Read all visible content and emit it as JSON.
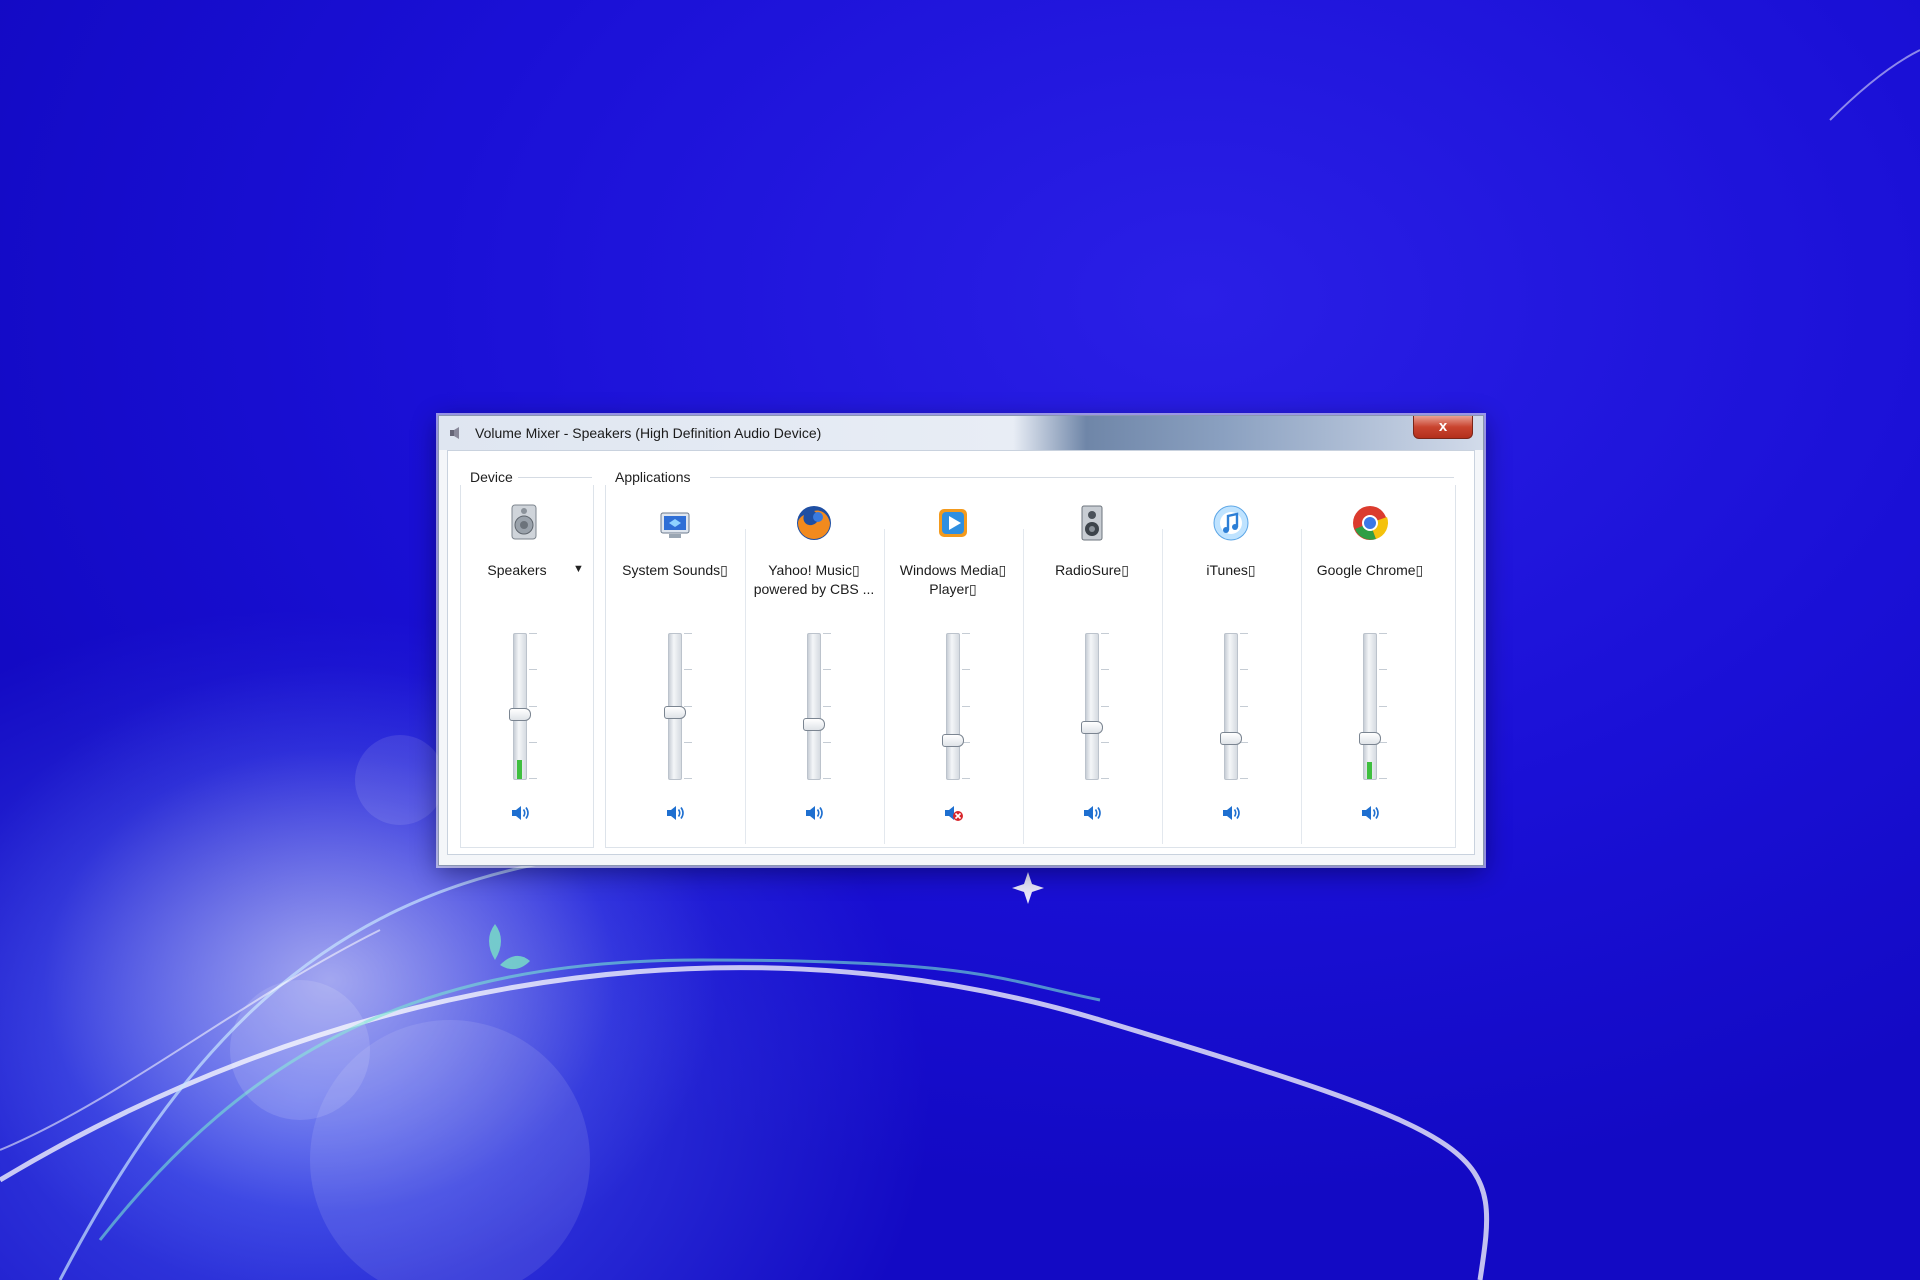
{
  "window": {
    "title": "Volume Mixer - Speakers (High Definition Audio Device)",
    "close_symbol": "x",
    "icon": "speaker-mixer-icon"
  },
  "groups": {
    "device_label": "Device",
    "applications_label": "Applications"
  },
  "device": {
    "label": "Speakers",
    "icon": "speakers-device-icon",
    "dropdown_icon": "chevron-down-icon",
    "volume": 0.45,
    "peak": 0.13,
    "muted": false
  },
  "applications": [
    {
      "id": "system-sounds",
      "label": "System Sounds▯",
      "icon": "system-sounds-icon",
      "volume": 0.46,
      "peak": 0,
      "muted": false
    },
    {
      "id": "yahoo-music",
      "label": "Yahoo! Music▯\npowered by CBS ...",
      "icon": "firefox-icon",
      "volume": 0.38,
      "peak": 0,
      "muted": false
    },
    {
      "id": "windows-media-player",
      "label": "Windows Media▯\nPlayer▯",
      "icon": "windows-media-player-icon",
      "volume": 0.27,
      "peak": 0,
      "muted": true
    },
    {
      "id": "radiosure",
      "label": "RadioSure▯",
      "icon": "radio-speaker-icon",
      "volume": 0.36,
      "peak": 0,
      "muted": false
    },
    {
      "id": "itunes",
      "label": "iTunes▯",
      "icon": "itunes-icon",
      "volume": 0.28,
      "peak": 0,
      "muted": false
    },
    {
      "id": "google-chrome",
      "label": "Google Chrome▯",
      "icon": "chrome-icon",
      "volume": 0.28,
      "peak": 0.12,
      "muted": false
    }
  ],
  "colors": {
    "desktop": "#1a10d6",
    "meter": "#3fbf3f",
    "speaker_blue": "#1e6fd0",
    "mute_red": "#d8262b",
    "close_red": "#c9442f"
  }
}
